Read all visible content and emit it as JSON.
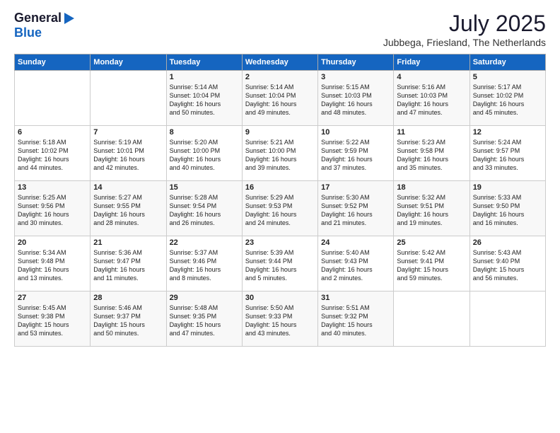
{
  "header": {
    "logo_general": "General",
    "logo_blue": "Blue",
    "month_year": "July 2025",
    "location": "Jubbega, Friesland, The Netherlands"
  },
  "days_of_week": [
    "Sunday",
    "Monday",
    "Tuesday",
    "Wednesday",
    "Thursday",
    "Friday",
    "Saturday"
  ],
  "weeks": [
    [
      {
        "day": "",
        "content": ""
      },
      {
        "day": "",
        "content": ""
      },
      {
        "day": "1",
        "content": "Sunrise: 5:14 AM\nSunset: 10:04 PM\nDaylight: 16 hours\nand 50 minutes."
      },
      {
        "day": "2",
        "content": "Sunrise: 5:14 AM\nSunset: 10:04 PM\nDaylight: 16 hours\nand 49 minutes."
      },
      {
        "day": "3",
        "content": "Sunrise: 5:15 AM\nSunset: 10:03 PM\nDaylight: 16 hours\nand 48 minutes."
      },
      {
        "day": "4",
        "content": "Sunrise: 5:16 AM\nSunset: 10:03 PM\nDaylight: 16 hours\nand 47 minutes."
      },
      {
        "day": "5",
        "content": "Sunrise: 5:17 AM\nSunset: 10:02 PM\nDaylight: 16 hours\nand 45 minutes."
      }
    ],
    [
      {
        "day": "6",
        "content": "Sunrise: 5:18 AM\nSunset: 10:02 PM\nDaylight: 16 hours\nand 44 minutes."
      },
      {
        "day": "7",
        "content": "Sunrise: 5:19 AM\nSunset: 10:01 PM\nDaylight: 16 hours\nand 42 minutes."
      },
      {
        "day": "8",
        "content": "Sunrise: 5:20 AM\nSunset: 10:00 PM\nDaylight: 16 hours\nand 40 minutes."
      },
      {
        "day": "9",
        "content": "Sunrise: 5:21 AM\nSunset: 10:00 PM\nDaylight: 16 hours\nand 39 minutes."
      },
      {
        "day": "10",
        "content": "Sunrise: 5:22 AM\nSunset: 9:59 PM\nDaylight: 16 hours\nand 37 minutes."
      },
      {
        "day": "11",
        "content": "Sunrise: 5:23 AM\nSunset: 9:58 PM\nDaylight: 16 hours\nand 35 minutes."
      },
      {
        "day": "12",
        "content": "Sunrise: 5:24 AM\nSunset: 9:57 PM\nDaylight: 16 hours\nand 33 minutes."
      }
    ],
    [
      {
        "day": "13",
        "content": "Sunrise: 5:25 AM\nSunset: 9:56 PM\nDaylight: 16 hours\nand 30 minutes."
      },
      {
        "day": "14",
        "content": "Sunrise: 5:27 AM\nSunset: 9:55 PM\nDaylight: 16 hours\nand 28 minutes."
      },
      {
        "day": "15",
        "content": "Sunrise: 5:28 AM\nSunset: 9:54 PM\nDaylight: 16 hours\nand 26 minutes."
      },
      {
        "day": "16",
        "content": "Sunrise: 5:29 AM\nSunset: 9:53 PM\nDaylight: 16 hours\nand 24 minutes."
      },
      {
        "day": "17",
        "content": "Sunrise: 5:30 AM\nSunset: 9:52 PM\nDaylight: 16 hours\nand 21 minutes."
      },
      {
        "day": "18",
        "content": "Sunrise: 5:32 AM\nSunset: 9:51 PM\nDaylight: 16 hours\nand 19 minutes."
      },
      {
        "day": "19",
        "content": "Sunrise: 5:33 AM\nSunset: 9:50 PM\nDaylight: 16 hours\nand 16 minutes."
      }
    ],
    [
      {
        "day": "20",
        "content": "Sunrise: 5:34 AM\nSunset: 9:48 PM\nDaylight: 16 hours\nand 13 minutes."
      },
      {
        "day": "21",
        "content": "Sunrise: 5:36 AM\nSunset: 9:47 PM\nDaylight: 16 hours\nand 11 minutes."
      },
      {
        "day": "22",
        "content": "Sunrise: 5:37 AM\nSunset: 9:46 PM\nDaylight: 16 hours\nand 8 minutes."
      },
      {
        "day": "23",
        "content": "Sunrise: 5:39 AM\nSunset: 9:44 PM\nDaylight: 16 hours\nand 5 minutes."
      },
      {
        "day": "24",
        "content": "Sunrise: 5:40 AM\nSunset: 9:43 PM\nDaylight: 16 hours\nand 2 minutes."
      },
      {
        "day": "25",
        "content": "Sunrise: 5:42 AM\nSunset: 9:41 PM\nDaylight: 15 hours\nand 59 minutes."
      },
      {
        "day": "26",
        "content": "Sunrise: 5:43 AM\nSunset: 9:40 PM\nDaylight: 15 hours\nand 56 minutes."
      }
    ],
    [
      {
        "day": "27",
        "content": "Sunrise: 5:45 AM\nSunset: 9:38 PM\nDaylight: 15 hours\nand 53 minutes."
      },
      {
        "day": "28",
        "content": "Sunrise: 5:46 AM\nSunset: 9:37 PM\nDaylight: 15 hours\nand 50 minutes."
      },
      {
        "day": "29",
        "content": "Sunrise: 5:48 AM\nSunset: 9:35 PM\nDaylight: 15 hours\nand 47 minutes."
      },
      {
        "day": "30",
        "content": "Sunrise: 5:50 AM\nSunset: 9:33 PM\nDaylight: 15 hours\nand 43 minutes."
      },
      {
        "day": "31",
        "content": "Sunrise: 5:51 AM\nSunset: 9:32 PM\nDaylight: 15 hours\nand 40 minutes."
      },
      {
        "day": "",
        "content": ""
      },
      {
        "day": "",
        "content": ""
      }
    ]
  ]
}
